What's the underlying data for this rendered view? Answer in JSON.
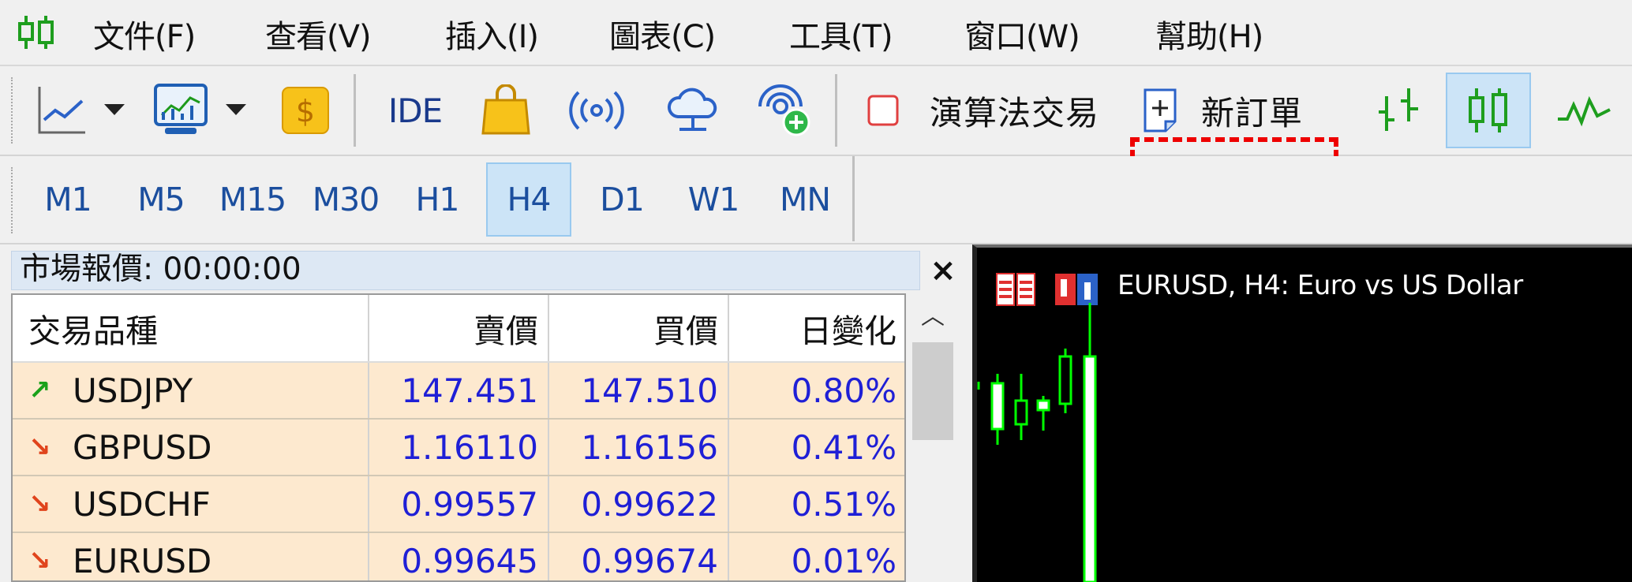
{
  "menu": {
    "items": [
      "文件(F)",
      "查看(V)",
      "插入(I)",
      "圖表(C)",
      "工具(T)",
      "窗口(W)",
      "幫助(H)"
    ]
  },
  "toolbar": {
    "ide_label": "IDE",
    "algo_label": "演算法交易",
    "new_order_label": "新訂單"
  },
  "timeframes": [
    "M1",
    "M5",
    "M15",
    "M30",
    "H1",
    "H4",
    "D1",
    "W1",
    "MN"
  ],
  "active_timeframe": "H4",
  "market_watch": {
    "title": "市場報價: 00:00:00",
    "close": "×",
    "columns": [
      "交易品種",
      "賣價",
      "買價",
      "日變化"
    ],
    "rows": [
      {
        "direction": "up",
        "arrow": "↗",
        "symbol": "USDJPY",
        "bid": "147.451",
        "ask": "147.510",
        "change": "0.80%"
      },
      {
        "direction": "down",
        "arrow": "↘",
        "symbol": "GBPUSD",
        "bid": "1.16110",
        "ask": "1.16156",
        "change": "0.41%"
      },
      {
        "direction": "down",
        "arrow": "↘",
        "symbol": "USDCHF",
        "bid": "0.99557",
        "ask": "0.99622",
        "change": "0.51%"
      },
      {
        "direction": "down",
        "arrow": "↘",
        "symbol": "EURUSD",
        "bid": "0.99645",
        "ask": "0.99674",
        "change": "0.01%"
      }
    ]
  },
  "chart": {
    "title": "EURUSD, H4:  Euro vs US Dollar"
  },
  "colors": {
    "up_arrow": "#1aa11a",
    "down_arrow": "#e0441c",
    "price_text": "#1f1fd6",
    "highlight": "#ee0000",
    "candle": "#00ff00"
  }
}
